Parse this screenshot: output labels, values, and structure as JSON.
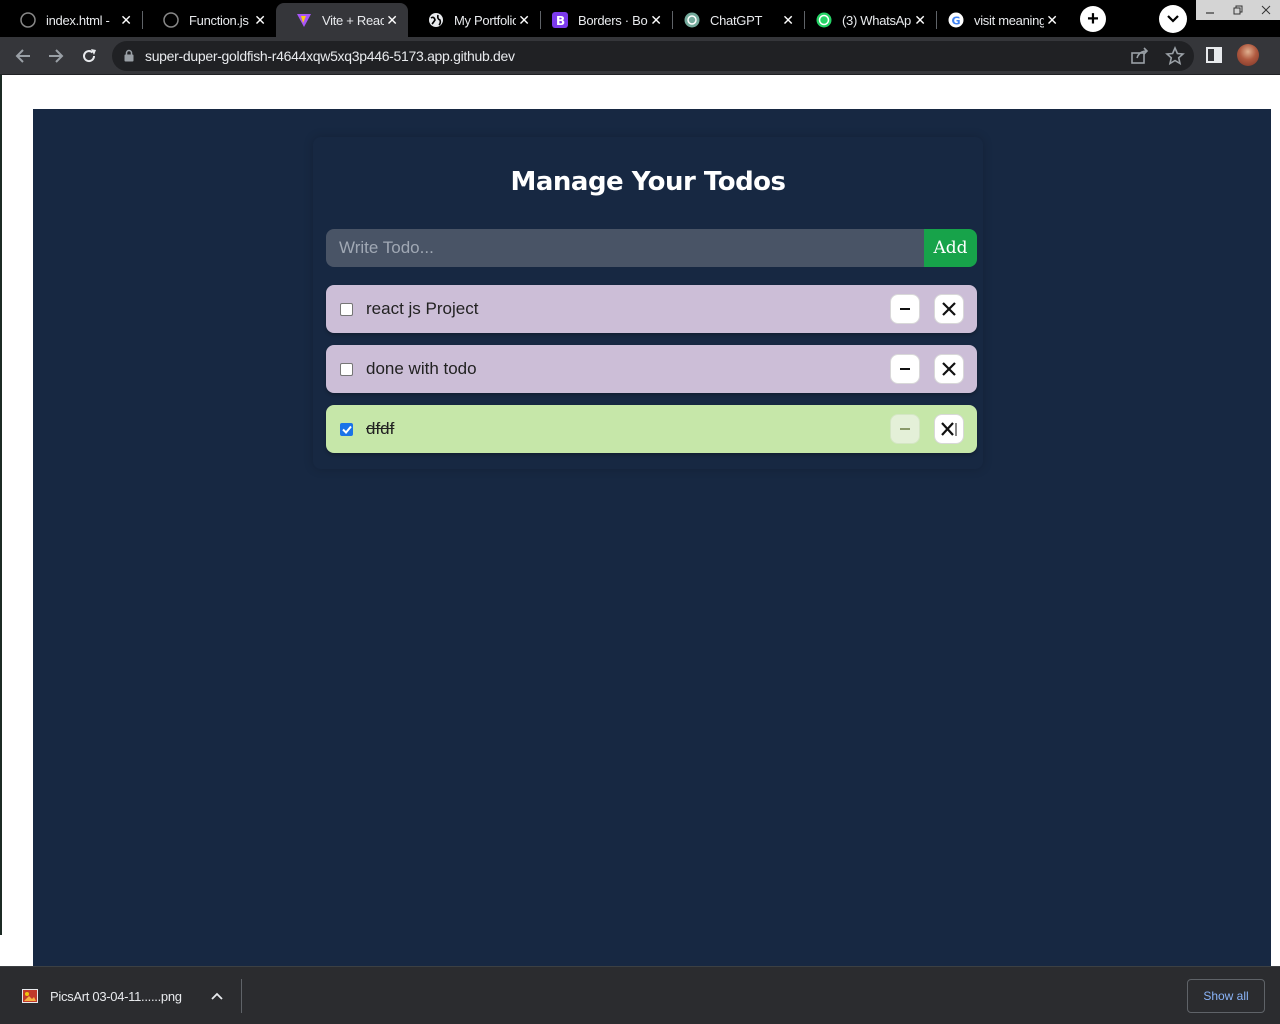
{
  "browser": {
    "tabs": [
      {
        "title": "index.html -",
        "icon": "github-icon",
        "active": false
      },
      {
        "title": "Function.js -",
        "icon": "github-icon",
        "active": false
      },
      {
        "title": "Vite + React",
        "icon": "vite-icon",
        "active": true
      },
      {
        "title": "My Portfolio",
        "icon": "globe-icon",
        "active": false
      },
      {
        "title": "Borders · Bo",
        "icon": "bootstrap-icon",
        "active": false
      },
      {
        "title": "ChatGPT",
        "icon": "chatgpt-icon",
        "active": false
      },
      {
        "title": "(3) WhatsAp",
        "icon": "whatsapp-icon",
        "active": false
      },
      {
        "title": "visit meaning",
        "icon": "google-icon",
        "active": false
      }
    ],
    "new_tab_symbol": "+",
    "close_symbol": "✕",
    "url": "super-duper-goldfish-r4644xqw5xq3p446-5173.app.github.dev"
  },
  "app": {
    "title": "Manage Your Todos",
    "input": {
      "placeholder": "Write Todo...",
      "value": ""
    },
    "add_label": "Add",
    "edit_symbol": "−",
    "delete_symbol": "✕",
    "todos": [
      {
        "text": "react js Project",
        "completed": false,
        "color": "#ccbed7"
      },
      {
        "text": "done with todo",
        "completed": false,
        "color": "#ccbed7"
      },
      {
        "text": "dfdf",
        "completed": true,
        "color": "#c6e7a9"
      }
    ],
    "colors": {
      "background": "#172842",
      "input_bg": "#495466",
      "add_button": "#17a34a"
    }
  },
  "downloads": {
    "file_name": "PicsArt 03-04-11......png",
    "show_all_label": "Show all"
  }
}
